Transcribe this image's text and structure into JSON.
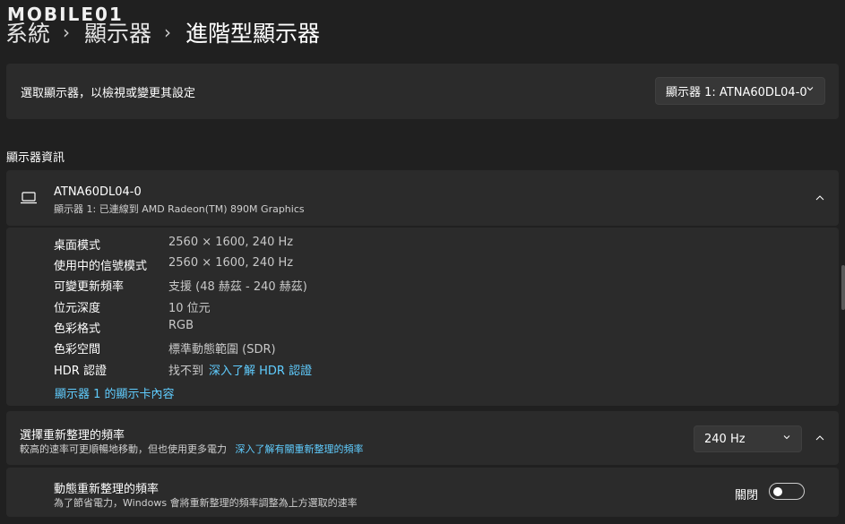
{
  "watermark": "MOBILE01",
  "breadcrumb": {
    "root": "系統",
    "parent": "顯示器",
    "current": "進階型顯示器"
  },
  "select_display": {
    "label": "選取顯示器，以檢視或變更其設定",
    "value": "顯示器 1: ATNA60DL04-0"
  },
  "section_title": "顯示器資訊",
  "display_info": {
    "name": "ATNA60DL04-0",
    "subtitle": "顯示器 1: 已連線到 AMD Radeon(TM) 890M Graphics",
    "rows": [
      {
        "key": "桌面模式",
        "value": "2560 × 1600, 240 Hz"
      },
      {
        "key": "使用中的信號模式",
        "value": "2560 × 1600, 240 Hz"
      },
      {
        "key": "可變更新頻率",
        "value": "支援 (48 赫茲 - 240 赫茲)"
      },
      {
        "key": "位元深度",
        "value": "10 位元"
      },
      {
        "key": "色彩格式",
        "value": "RGB"
      },
      {
        "key": "色彩空間",
        "value": "標準動態範圍 (SDR)"
      },
      {
        "key": "HDR 認證",
        "value": "找不到",
        "link": "深入了解 HDR 認證"
      }
    ],
    "adapter_link": "顯示器 1 的顯示卡內容"
  },
  "refresh_rate": {
    "title": "選擇重新整理的頻率",
    "subtitle": "較高的速率可更順暢地移動，但也使用更多電力",
    "link": "深入了解有關重新整理的頻率",
    "value": "240 Hz"
  },
  "dynamic_refresh": {
    "title": "動態重新整理的頻率",
    "subtitle": "為了節省電力，Windows 會將重新整理的頻率調整為上方選取的速率",
    "toggle_label": "關閉"
  },
  "colors": {
    "background": "#202020",
    "card": "#2b2b2b",
    "link": "#60cdff"
  }
}
